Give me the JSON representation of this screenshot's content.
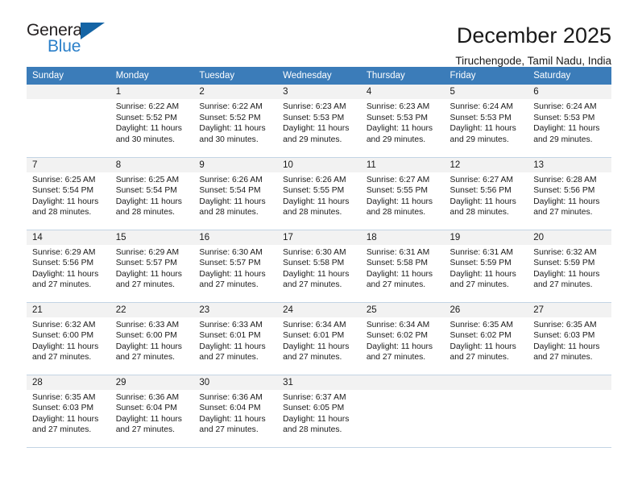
{
  "brand": {
    "logo_text_top": "General",
    "logo_text_bottom": "Blue",
    "accent_color": "#2a7fc9",
    "triangle_color": "#1464a5",
    "triangle_icon": "triangle-icon"
  },
  "header": {
    "title": "December 2025",
    "subtitle": "Tiruchengode, Tamil Nadu, India"
  },
  "calendar": {
    "header_bg": "#3b7cb9",
    "daynum_bg": "#f2f2f2",
    "weekday_headers": [
      "Sunday",
      "Monday",
      "Tuesday",
      "Wednesday",
      "Thursday",
      "Friday",
      "Saturday"
    ],
    "weeks": [
      [
        {
          "day": "",
          "sunrise": "",
          "sunset": "",
          "daylight1": "",
          "daylight2": ""
        },
        {
          "day": "1",
          "sunrise": "Sunrise: 6:22 AM",
          "sunset": "Sunset: 5:52 PM",
          "daylight1": "Daylight: 11 hours",
          "daylight2": "and 30 minutes."
        },
        {
          "day": "2",
          "sunrise": "Sunrise: 6:22 AM",
          "sunset": "Sunset: 5:52 PM",
          "daylight1": "Daylight: 11 hours",
          "daylight2": "and 30 minutes."
        },
        {
          "day": "3",
          "sunrise": "Sunrise: 6:23 AM",
          "sunset": "Sunset: 5:53 PM",
          "daylight1": "Daylight: 11 hours",
          "daylight2": "and 29 minutes."
        },
        {
          "day": "4",
          "sunrise": "Sunrise: 6:23 AM",
          "sunset": "Sunset: 5:53 PM",
          "daylight1": "Daylight: 11 hours",
          "daylight2": "and 29 minutes."
        },
        {
          "day": "5",
          "sunrise": "Sunrise: 6:24 AM",
          "sunset": "Sunset: 5:53 PM",
          "daylight1": "Daylight: 11 hours",
          "daylight2": "and 29 minutes."
        },
        {
          "day": "6",
          "sunrise": "Sunrise: 6:24 AM",
          "sunset": "Sunset: 5:53 PM",
          "daylight1": "Daylight: 11 hours",
          "daylight2": "and 29 minutes."
        }
      ],
      [
        {
          "day": "7",
          "sunrise": "Sunrise: 6:25 AM",
          "sunset": "Sunset: 5:54 PM",
          "daylight1": "Daylight: 11 hours",
          "daylight2": "and 28 minutes."
        },
        {
          "day": "8",
          "sunrise": "Sunrise: 6:25 AM",
          "sunset": "Sunset: 5:54 PM",
          "daylight1": "Daylight: 11 hours",
          "daylight2": "and 28 minutes."
        },
        {
          "day": "9",
          "sunrise": "Sunrise: 6:26 AM",
          "sunset": "Sunset: 5:54 PM",
          "daylight1": "Daylight: 11 hours",
          "daylight2": "and 28 minutes."
        },
        {
          "day": "10",
          "sunrise": "Sunrise: 6:26 AM",
          "sunset": "Sunset: 5:55 PM",
          "daylight1": "Daylight: 11 hours",
          "daylight2": "and 28 minutes."
        },
        {
          "day": "11",
          "sunrise": "Sunrise: 6:27 AM",
          "sunset": "Sunset: 5:55 PM",
          "daylight1": "Daylight: 11 hours",
          "daylight2": "and 28 minutes."
        },
        {
          "day": "12",
          "sunrise": "Sunrise: 6:27 AM",
          "sunset": "Sunset: 5:56 PM",
          "daylight1": "Daylight: 11 hours",
          "daylight2": "and 28 minutes."
        },
        {
          "day": "13",
          "sunrise": "Sunrise: 6:28 AM",
          "sunset": "Sunset: 5:56 PM",
          "daylight1": "Daylight: 11 hours",
          "daylight2": "and 27 minutes."
        }
      ],
      [
        {
          "day": "14",
          "sunrise": "Sunrise: 6:29 AM",
          "sunset": "Sunset: 5:56 PM",
          "daylight1": "Daylight: 11 hours",
          "daylight2": "and 27 minutes."
        },
        {
          "day": "15",
          "sunrise": "Sunrise: 6:29 AM",
          "sunset": "Sunset: 5:57 PM",
          "daylight1": "Daylight: 11 hours",
          "daylight2": "and 27 minutes."
        },
        {
          "day": "16",
          "sunrise": "Sunrise: 6:30 AM",
          "sunset": "Sunset: 5:57 PM",
          "daylight1": "Daylight: 11 hours",
          "daylight2": "and 27 minutes."
        },
        {
          "day": "17",
          "sunrise": "Sunrise: 6:30 AM",
          "sunset": "Sunset: 5:58 PM",
          "daylight1": "Daylight: 11 hours",
          "daylight2": "and 27 minutes."
        },
        {
          "day": "18",
          "sunrise": "Sunrise: 6:31 AM",
          "sunset": "Sunset: 5:58 PM",
          "daylight1": "Daylight: 11 hours",
          "daylight2": "and 27 minutes."
        },
        {
          "day": "19",
          "sunrise": "Sunrise: 6:31 AM",
          "sunset": "Sunset: 5:59 PM",
          "daylight1": "Daylight: 11 hours",
          "daylight2": "and 27 minutes."
        },
        {
          "day": "20",
          "sunrise": "Sunrise: 6:32 AM",
          "sunset": "Sunset: 5:59 PM",
          "daylight1": "Daylight: 11 hours",
          "daylight2": "and 27 minutes."
        }
      ],
      [
        {
          "day": "21",
          "sunrise": "Sunrise: 6:32 AM",
          "sunset": "Sunset: 6:00 PM",
          "daylight1": "Daylight: 11 hours",
          "daylight2": "and 27 minutes."
        },
        {
          "day": "22",
          "sunrise": "Sunrise: 6:33 AM",
          "sunset": "Sunset: 6:00 PM",
          "daylight1": "Daylight: 11 hours",
          "daylight2": "and 27 minutes."
        },
        {
          "day": "23",
          "sunrise": "Sunrise: 6:33 AM",
          "sunset": "Sunset: 6:01 PM",
          "daylight1": "Daylight: 11 hours",
          "daylight2": "and 27 minutes."
        },
        {
          "day": "24",
          "sunrise": "Sunrise: 6:34 AM",
          "sunset": "Sunset: 6:01 PM",
          "daylight1": "Daylight: 11 hours",
          "daylight2": "and 27 minutes."
        },
        {
          "day": "25",
          "sunrise": "Sunrise: 6:34 AM",
          "sunset": "Sunset: 6:02 PM",
          "daylight1": "Daylight: 11 hours",
          "daylight2": "and 27 minutes."
        },
        {
          "day": "26",
          "sunrise": "Sunrise: 6:35 AM",
          "sunset": "Sunset: 6:02 PM",
          "daylight1": "Daylight: 11 hours",
          "daylight2": "and 27 minutes."
        },
        {
          "day": "27",
          "sunrise": "Sunrise: 6:35 AM",
          "sunset": "Sunset: 6:03 PM",
          "daylight1": "Daylight: 11 hours",
          "daylight2": "and 27 minutes."
        }
      ],
      [
        {
          "day": "28",
          "sunrise": "Sunrise: 6:35 AM",
          "sunset": "Sunset: 6:03 PM",
          "daylight1": "Daylight: 11 hours",
          "daylight2": "and 27 minutes."
        },
        {
          "day": "29",
          "sunrise": "Sunrise: 6:36 AM",
          "sunset": "Sunset: 6:04 PM",
          "daylight1": "Daylight: 11 hours",
          "daylight2": "and 27 minutes."
        },
        {
          "day": "30",
          "sunrise": "Sunrise: 6:36 AM",
          "sunset": "Sunset: 6:04 PM",
          "daylight1": "Daylight: 11 hours",
          "daylight2": "and 27 minutes."
        },
        {
          "day": "31",
          "sunrise": "Sunrise: 6:37 AM",
          "sunset": "Sunset: 6:05 PM",
          "daylight1": "Daylight: 11 hours",
          "daylight2": "and 28 minutes."
        },
        {
          "day": "",
          "sunrise": "",
          "sunset": "",
          "daylight1": "",
          "daylight2": ""
        },
        {
          "day": "",
          "sunrise": "",
          "sunset": "",
          "daylight1": "",
          "daylight2": ""
        },
        {
          "day": "",
          "sunrise": "",
          "sunset": "",
          "daylight1": "",
          "daylight2": ""
        }
      ]
    ]
  }
}
